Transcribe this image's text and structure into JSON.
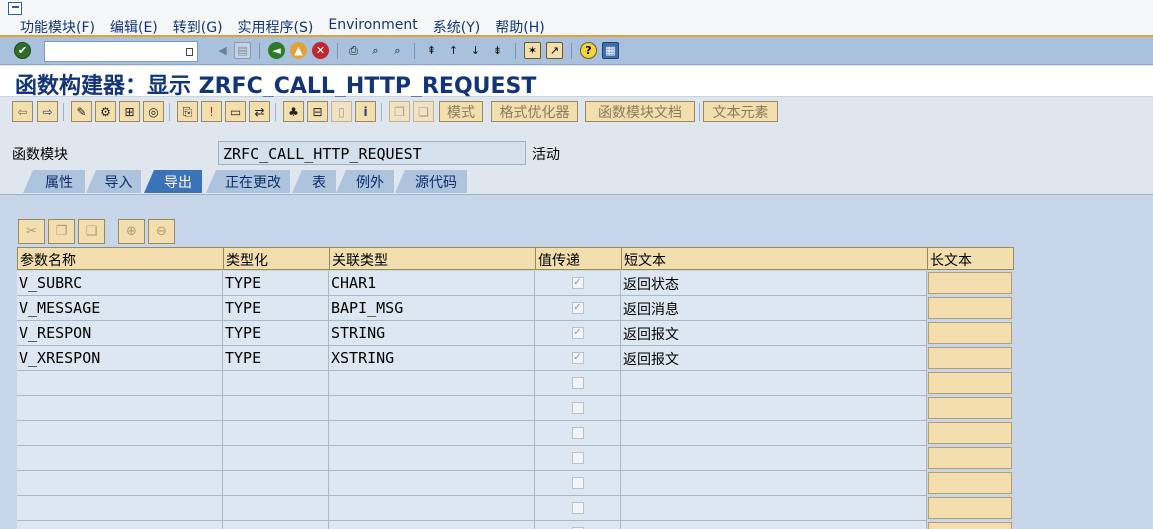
{
  "menubar": {
    "items": [
      "功能模块(F)",
      "编辑(E)",
      "转到(G)",
      "实用程序(S)",
      "Environment",
      "系统(Y)",
      "帮助(H)"
    ]
  },
  "stdbar": {
    "command_field_value": "",
    "icons": [
      "enter-icon",
      "save-icon",
      "back-icon",
      "exit-icon",
      "cancel-icon",
      "print-icon",
      "find-icon",
      "find-next-icon",
      "first-page-icon",
      "previous-page-icon",
      "next-page-icon",
      "last-page-icon",
      "create-session-icon",
      "shortcut-icon",
      "help-icon",
      "layout-icon"
    ]
  },
  "title": "函数构建器：显示 ZRFC_CALL_HTTP_REQUEST",
  "apptoolbar": {
    "buttons": [
      "模式",
      "格式优化器",
      "函数模块文档",
      "文本元素"
    ]
  },
  "function_module": {
    "label": "函数模块",
    "value": "ZRFC_CALL_HTTP_REQUEST",
    "status": "活动"
  },
  "tabs": [
    {
      "label": "属性",
      "active": false
    },
    {
      "label": "导入",
      "active": false
    },
    {
      "label": "导出",
      "active": true
    },
    {
      "label": "正在更改",
      "active": false
    },
    {
      "label": "表",
      "active": false
    },
    {
      "label": "例外",
      "active": false
    },
    {
      "label": "源代码",
      "active": false
    }
  ],
  "table": {
    "headers": [
      "参数名称",
      "类型化",
      "关联类型",
      "值传递",
      "短文本",
      "长文本"
    ],
    "rows": [
      {
        "name": "V_SUBRC",
        "typing": "TYPE",
        "assoc_type": "CHAR1",
        "pass_by_value": true,
        "short_text": "返回状态"
      },
      {
        "name": "V_MESSAGE",
        "typing": "TYPE",
        "assoc_type": "BAPI_MSG",
        "pass_by_value": true,
        "short_text": "返回消息"
      },
      {
        "name": "V_RESPON",
        "typing": "TYPE",
        "assoc_type": "STRING",
        "pass_by_value": true,
        "short_text": "返回报文"
      },
      {
        "name": "V_XRESPON",
        "typing": "TYPE",
        "assoc_type": "XSTRING",
        "pass_by_value": true,
        "short_text": "返回报文"
      },
      {
        "name": "",
        "typing": "",
        "assoc_type": "",
        "pass_by_value": false,
        "short_text": ""
      },
      {
        "name": "",
        "typing": "",
        "assoc_type": "",
        "pass_by_value": false,
        "short_text": ""
      },
      {
        "name": "",
        "typing": "",
        "assoc_type": "",
        "pass_by_value": false,
        "short_text": ""
      },
      {
        "name": "",
        "typing": "",
        "assoc_type": "",
        "pass_by_value": false,
        "short_text": ""
      },
      {
        "name": "",
        "typing": "",
        "assoc_type": "",
        "pass_by_value": false,
        "short_text": ""
      },
      {
        "name": "",
        "typing": "",
        "assoc_type": "",
        "pass_by_value": false,
        "short_text": ""
      },
      {
        "name": "",
        "typing": "",
        "assoc_type": "",
        "pass_by_value": false,
        "short_text": ""
      }
    ]
  },
  "colors": {
    "title": "#12357a",
    "stdbar_bg": "#a9c1dc",
    "active_tab": "#3b72b8",
    "header_bg": "#f3dfae",
    "accent_line": "#e3a13a"
  }
}
